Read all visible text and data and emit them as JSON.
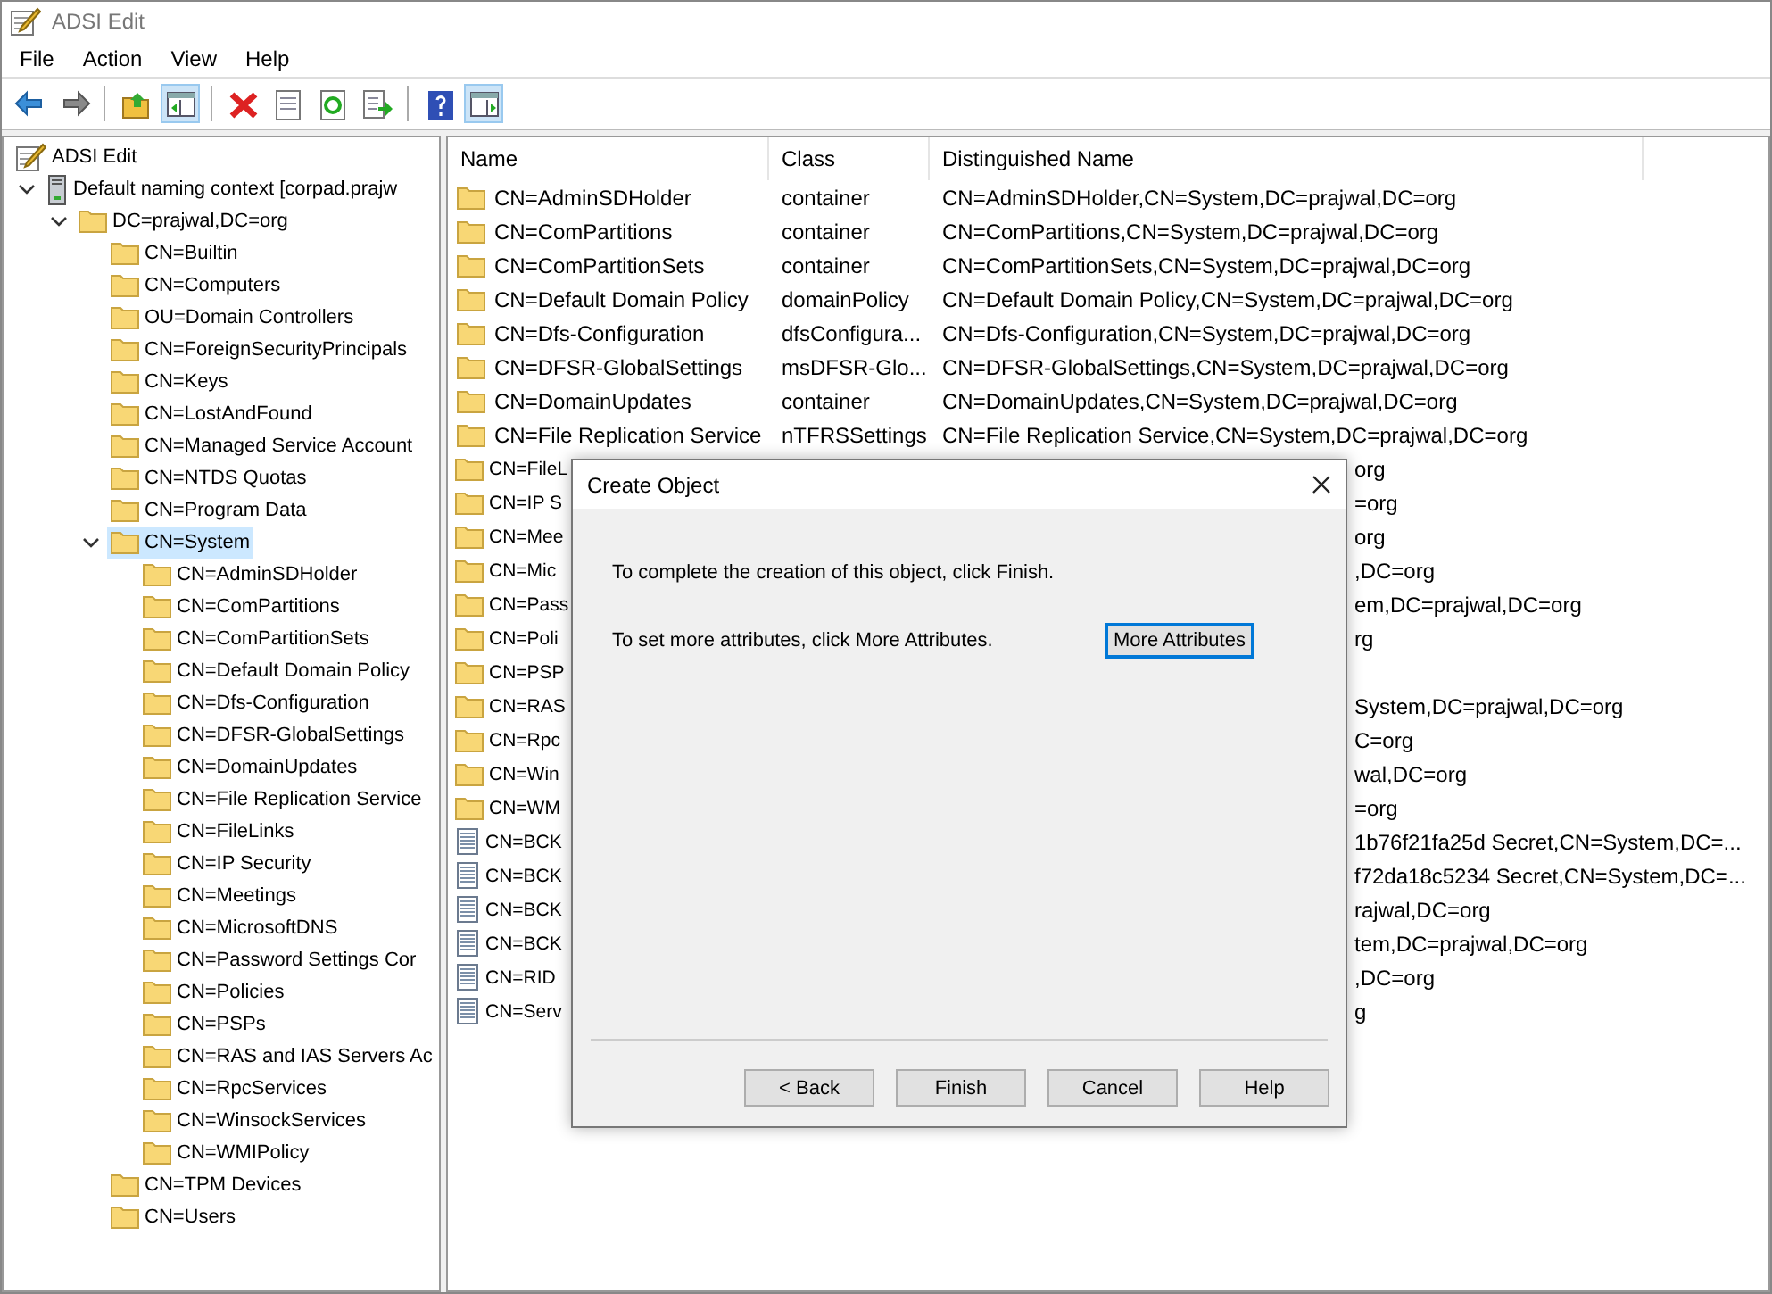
{
  "window": {
    "title": "ADSI Edit"
  },
  "menu": [
    "File",
    "Action",
    "View",
    "Help"
  ],
  "toolbar": [
    {
      "kind": "back",
      "pressed": false
    },
    {
      "kind": "forward",
      "pressed": false
    },
    {
      "kind": "sep"
    },
    {
      "kind": "up",
      "pressed": false
    },
    {
      "kind": "tree",
      "pressed": true
    },
    {
      "kind": "sep"
    },
    {
      "kind": "delete",
      "pressed": false
    },
    {
      "kind": "properties",
      "pressed": false
    },
    {
      "kind": "refresh",
      "pressed": false
    },
    {
      "kind": "export",
      "pressed": false
    },
    {
      "kind": "sep"
    },
    {
      "kind": "help",
      "pressed": false
    },
    {
      "kind": "action",
      "pressed": true
    }
  ],
  "tree": [
    {
      "label": "ADSI Edit",
      "kind": "snapin",
      "selected": false,
      "children": [
        {
          "label": "Default naming context [corpad.prajw",
          "kind": "server",
          "expanded": true,
          "selected": false,
          "children": [
            {
              "label": "DC=prajwal,DC=org",
              "expanded": true,
              "selected": false,
              "children": [
                {
                  "label": "CN=Builtin",
                  "selected": false
                },
                {
                  "label": "CN=Computers",
                  "selected": false
                },
                {
                  "label": "OU=Domain Controllers",
                  "selected": false
                },
                {
                  "label": "CN=ForeignSecurityPrincipals",
                  "selected": false
                },
                {
                  "label": "CN=Keys",
                  "selected": false
                },
                {
                  "label": "CN=LostAndFound",
                  "selected": false
                },
                {
                  "label": "CN=Managed Service Account",
                  "selected": false
                },
                {
                  "label": "CN=NTDS Quotas",
                  "selected": false
                },
                {
                  "label": "CN=Program Data",
                  "selected": false
                },
                {
                  "label": "CN=System",
                  "expanded": true,
                  "selected": true,
                  "children": [
                    {
                      "label": "CN=AdminSDHolder",
                      "selected": false
                    },
                    {
                      "label": "CN=ComPartitions",
                      "selected": false
                    },
                    {
                      "label": "CN=ComPartitionSets",
                      "selected": false
                    },
                    {
                      "label": "CN=Default Domain Policy",
                      "selected": false
                    },
                    {
                      "label": "CN=Dfs-Configuration",
                      "selected": false
                    },
                    {
                      "label": "CN=DFSR-GlobalSettings",
                      "selected": false
                    },
                    {
                      "label": "CN=DomainUpdates",
                      "selected": false
                    },
                    {
                      "label": "CN=File Replication Service",
                      "selected": false
                    },
                    {
                      "label": "CN=FileLinks",
                      "selected": false
                    },
                    {
                      "label": "CN=IP Security",
                      "selected": false
                    },
                    {
                      "label": "CN=Meetings",
                      "selected": false
                    },
                    {
                      "label": "CN=MicrosoftDNS",
                      "selected": false
                    },
                    {
                      "label": "CN=Password Settings Cor",
                      "selected": false
                    },
                    {
                      "label": "CN=Policies",
                      "selected": false
                    },
                    {
                      "label": "CN=PSPs",
                      "selected": false
                    },
                    {
                      "label": "CN=RAS and IAS Servers Ac",
                      "selected": false
                    },
                    {
                      "label": "CN=RpcServices",
                      "selected": false
                    },
                    {
                      "label": "CN=WinsockServices",
                      "selected": false
                    },
                    {
                      "label": "CN=WMIPolicy",
                      "selected": false
                    }
                  ]
                },
                {
                  "label": "CN=TPM Devices",
                  "selected": false
                },
                {
                  "label": "CN=Users",
                  "selected": false
                }
              ]
            }
          ]
        }
      ]
    }
  ],
  "list": {
    "columns": [
      "Name",
      "Class",
      "Distinguished Name"
    ],
    "rows": [
      {
        "kind": "folder",
        "name": "CN=AdminSDHolder",
        "class": "container",
        "dn": "CN=AdminSDHolder,CN=System,DC=prajwal,DC=org"
      },
      {
        "kind": "folder",
        "name": "CN=ComPartitions",
        "class": "container",
        "dn": "CN=ComPartitions,CN=System,DC=prajwal,DC=org"
      },
      {
        "kind": "folder",
        "name": "CN=ComPartitionSets",
        "class": "container",
        "dn": "CN=ComPartitionSets,CN=System,DC=prajwal,DC=org"
      },
      {
        "kind": "folder",
        "name": "CN=Default Domain Policy",
        "class": "domainPolicy",
        "dn": "CN=Default Domain Policy,CN=System,DC=prajwal,DC=org"
      },
      {
        "kind": "folder",
        "name": "CN=Dfs-Configuration",
        "class": "dfsConfigura...",
        "dn": "CN=Dfs-Configuration,CN=System,DC=prajwal,DC=org"
      },
      {
        "kind": "folder",
        "name": "CN=DFSR-GlobalSettings",
        "class": "msDFSR-Glo...",
        "dn": "CN=DFSR-GlobalSettings,CN=System,DC=prajwal,DC=org"
      },
      {
        "kind": "folder",
        "name": "CN=DomainUpdates",
        "class": "container",
        "dn": "CN=DomainUpdates,CN=System,DC=prajwal,DC=org"
      },
      {
        "kind": "folder",
        "name": "CN=File Replication Service",
        "class": "nTFRSSettings",
        "dn": "CN=File Replication Service,CN=System,DC=prajwal,DC=org"
      },
      {
        "kind": "folder",
        "name": "CN=FileL",
        "dn": "org"
      },
      {
        "kind": "folder",
        "name": "CN=IP S",
        "dn": "=org"
      },
      {
        "kind": "folder",
        "name": "CN=Mee",
        "dn": "org"
      },
      {
        "kind": "folder",
        "name": "CN=Mic",
        "dn": ",DC=org"
      },
      {
        "kind": "folder",
        "name": "CN=Pass",
        "dn": "em,DC=prajwal,DC=org"
      },
      {
        "kind": "folder",
        "name": "CN=Poli",
        "dn": "rg"
      },
      {
        "kind": "folder",
        "name": "CN=PSP"
      },
      {
        "kind": "folder",
        "name": "CN=RAS",
        "dn": "System,DC=prajwal,DC=org"
      },
      {
        "kind": "folder",
        "name": "CN=Rpc",
        "dn": "C=org"
      },
      {
        "kind": "folder",
        "name": "CN=Win",
        "dn": "wal,DC=org"
      },
      {
        "kind": "folder",
        "name": "CN=WM",
        "dn": "=org"
      },
      {
        "kind": "object",
        "name": "CN=BCK",
        "dn": "1b76f21fa25d Secret,CN=System,DC=..."
      },
      {
        "kind": "object",
        "name": "CN=BCK",
        "dn": "f72da18c5234 Secret,CN=System,DC=..."
      },
      {
        "kind": "object",
        "name": "CN=BCK",
        "dn": "rajwal,DC=org"
      },
      {
        "kind": "object",
        "name": "CN=BCK",
        "dn": "tem,DC=prajwal,DC=org"
      },
      {
        "kind": "object",
        "name": "CN=RID",
        "dn": ",DC=org"
      },
      {
        "kind": "object",
        "name": "CN=Serv",
        "dn": "g"
      }
    ]
  },
  "dialog": {
    "title": "Create Object",
    "message": "To complete the creation of this object, click Finish.",
    "hint": "To set more attributes, click More Attributes.",
    "more_button": "More Attributes",
    "buttons": [
      "< Back",
      "Finish",
      "Cancel",
      "Help"
    ]
  }
}
